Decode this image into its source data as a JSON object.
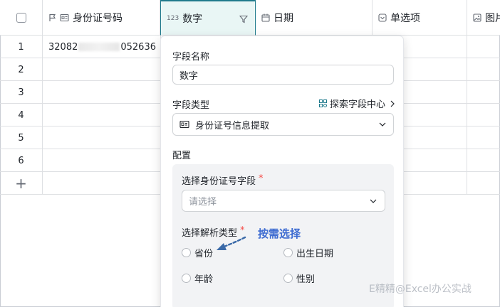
{
  "columns": [
    {
      "label": "身份证号码",
      "icons": [
        "flag-icon",
        "id-card-icon"
      ]
    },
    {
      "label": "数字",
      "icon_text": "123",
      "filter_icon": "funnel-icon"
    },
    {
      "label": "日期",
      "icon": "calendar-icon"
    },
    {
      "label": "单选项",
      "icon": "select-icon"
    },
    {
      "label": "图片",
      "icon": "image-icon"
    }
  ],
  "rows": [
    {
      "num": "1",
      "id_prefix": "32082",
      "id_suffix": "052636"
    },
    {
      "num": "2"
    },
    {
      "num": "3"
    },
    {
      "num": "4"
    },
    {
      "num": "5"
    },
    {
      "num": "6"
    }
  ],
  "add_row_symbol": "+",
  "panel": {
    "field_name_label": "字段名称",
    "field_name_value": "数字",
    "field_type_label": "字段类型",
    "explore_link": "探索字段中心",
    "field_type_value": "身份证号信息提取",
    "config_label": "配置",
    "select_field_label": "选择身份证号字段",
    "required_mark": "*",
    "select_placeholder": "请选择",
    "parse_type_label": "选择解析类型",
    "options": [
      "省份",
      "出生日期",
      "年龄",
      "性别"
    ]
  },
  "annotation": "按需选择",
  "watermark": "E精精@Excel办公实战",
  "colors": {
    "accent": "#1f7a8c",
    "selected_bg": "#e9f6f5",
    "annotation": "#3d6bd1",
    "arrow": "#3b6aa8"
  }
}
